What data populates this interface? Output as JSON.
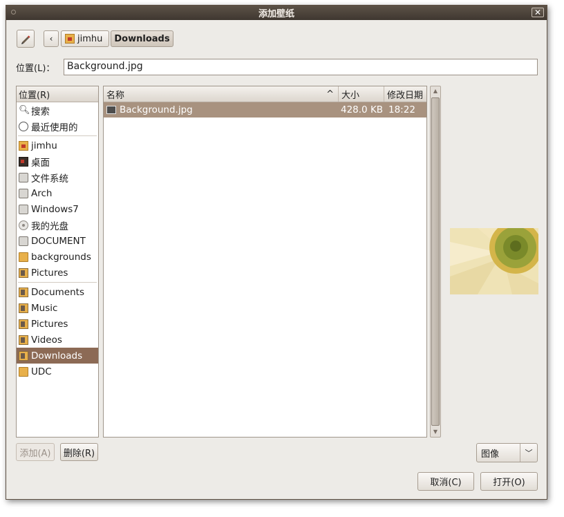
{
  "window": {
    "title": "添加壁纸",
    "close_glyph": "✕"
  },
  "toolbar": {
    "edit_icon": "pencil-icon",
    "back_glyph": "‹",
    "breadcrumbs": [
      {
        "label": "jimhu",
        "icon": "home-folder-icon"
      },
      {
        "label": "Downloads"
      }
    ]
  },
  "location": {
    "label": "位置(L)：",
    "value": "Background.jpg"
  },
  "sidebar": {
    "header": "位置(R)",
    "groups": [
      [
        {
          "label": "搜索",
          "icon": "search-icon"
        },
        {
          "label": "最近使用的",
          "icon": "recent-icon"
        }
      ],
      [
        {
          "label": "jimhu",
          "icon": "home-icon"
        },
        {
          "label": "桌面",
          "icon": "desktop-icon"
        },
        {
          "label": "文件系统",
          "icon": "drive-icon"
        },
        {
          "label": "Arch",
          "icon": "drive-icon"
        },
        {
          "label": "Windows7",
          "icon": "drive-icon"
        },
        {
          "label": "我的光盘",
          "icon": "cd-icon"
        },
        {
          "label": "DOCUMENT",
          "icon": "drive-icon"
        },
        {
          "label": "backgrounds",
          "icon": "folder-icon"
        },
        {
          "label": "Pictures",
          "icon": "pictures-icon"
        }
      ],
      [
        {
          "label": "Documents",
          "icon": "documents-icon"
        },
        {
          "label": "Music",
          "icon": "music-icon"
        },
        {
          "label": "Pictures",
          "icon": "pictures-icon"
        },
        {
          "label": "Videos",
          "icon": "videos-icon"
        },
        {
          "label": "Downloads",
          "icon": "downloads-icon",
          "selected": true
        },
        {
          "label": "UDC",
          "icon": "folder-icon"
        }
      ]
    ]
  },
  "filelist": {
    "columns": {
      "name": "名称",
      "size": "大小",
      "modified": "修改日期",
      "sort_glyph": "^"
    },
    "rows": [
      {
        "name": "Background.jpg",
        "size": "428.0 KB",
        "modified": "18:22",
        "selected": true
      }
    ]
  },
  "buttons": {
    "add": "添加(A)",
    "remove": "删除(R)",
    "cancel": "取消(C)",
    "open": "打开(O)"
  },
  "filter": {
    "selected": "图像",
    "arrow_glyph": "﹀"
  },
  "colors": {
    "selection": "#8c6a55",
    "file_selection": "#a8927f",
    "titlebar": "#4a4139"
  }
}
